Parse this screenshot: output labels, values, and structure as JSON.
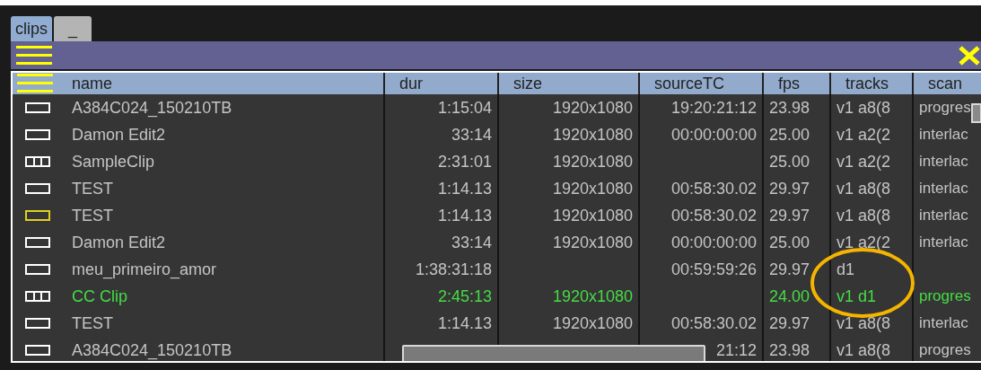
{
  "tabs": [
    {
      "label": "clips",
      "selected": true
    },
    {
      "label": "_",
      "selected": false
    }
  ],
  "table": {
    "columns": [
      "name",
      "dur",
      "size",
      "sourceTC",
      "fps",
      "tracks",
      "scan"
    ],
    "rows": [
      {
        "kind": "clip",
        "selected": false,
        "color": "#c4c4c4",
        "cells": [
          "A384C024_150210TB",
          "1:15:04",
          "1920x1080",
          "19:20:21:12",
          "23.98",
          "v1 a8(8",
          "progres"
        ]
      },
      {
        "kind": "clip",
        "selected": false,
        "color": "#c4c4c4",
        "cells": [
          "Damon Edit2",
          "33:14",
          "1920x1080",
          "00:00:00:00",
          "25.00",
          "v1 a2(2",
          "interlac"
        ]
      },
      {
        "kind": "multi",
        "selected": false,
        "color": "#c4c4c4",
        "cells": [
          "SampleClip",
          "2:31:01",
          "1920x1080",
          "",
          "25.00",
          "v1 a2(2",
          "interlac"
        ]
      },
      {
        "kind": "clip",
        "selected": false,
        "color": "#c4c4c4",
        "cells": [
          "TEST",
          "1:14.13",
          "1920x1080",
          "00:58:30.02",
          "29.97",
          "v1 a8(8",
          "interlac"
        ]
      },
      {
        "kind": "clip",
        "selected": true,
        "color": "#c4c4c4",
        "cells": [
          "TEST",
          "1:14.13",
          "1920x1080",
          "00:58:30.02",
          "29.97",
          "v1 a8(8",
          "interlac"
        ]
      },
      {
        "kind": "clip",
        "selected": false,
        "color": "#c4c4c4",
        "cells": [
          "Damon Edit2",
          "33:14",
          "1920x1080",
          "00:00:00:00",
          "25.00",
          "v1 a2(2",
          "interlac"
        ]
      },
      {
        "kind": "clip",
        "selected": false,
        "color": "#c4c4c4",
        "cells": [
          "meu_primeiro_amor",
          "1:38:31:18",
          "",
          "00:59:59:26",
          "29.97",
          "d1",
          ""
        ]
      },
      {
        "kind": "multi",
        "selected": false,
        "color": "#44dd44",
        "cells": [
          "CC Clip",
          "2:45:13",
          "1920x1080",
          "",
          "24.00",
          "v1 d1",
          "progres"
        ]
      },
      {
        "kind": "clip",
        "selected": false,
        "color": "#c4c4c4",
        "cells": [
          "TEST",
          "1:14.13",
          "1920x1080",
          "00:58:30.02",
          "29.97",
          "v1 a8(8",
          "interlac"
        ]
      },
      {
        "kind": "clip",
        "selected": false,
        "color": "#c4c4c4",
        "cells": [
          "A384C024_150210TB",
          null,
          null,
          "21:12",
          "23.98",
          "v1 a8(8",
          "progres"
        ]
      }
    ]
  }
}
